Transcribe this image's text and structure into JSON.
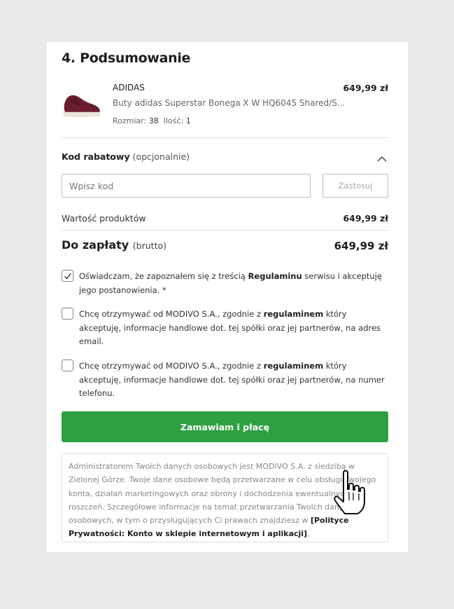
{
  "summary": {
    "title": "4. Podsumowanie"
  },
  "product": {
    "brand": "ADIDAS",
    "name": "Buty adidas Superstar Bonega X W HQ6045 Shared/S...",
    "price": "649,99 zł",
    "size_label": "Rozmiar:",
    "size_value": "38",
    "qty_label": "Ilość:",
    "qty_value": "1"
  },
  "discount": {
    "label_bold": "Kod rabatowy",
    "label_optional": "(opcjonalnie)",
    "placeholder": "Wpisz kod",
    "apply_label": "Zastosuj"
  },
  "totals": {
    "products_label": "Wartość produktów",
    "products_value": "649,99 zł",
    "pay_label": "Do zapłaty",
    "pay_note": "(brutto)",
    "pay_value": "649,99 zł"
  },
  "consents": [
    {
      "checked": true,
      "text_before": "Oświadczam, że zapoznałem się z treścią ",
      "bold": "Regulaminu",
      "text_after": " serwisu i akceptuję jego postanowienia. *"
    },
    {
      "checked": false,
      "text_before": "Chcę otrzymywać od MODIVO S.A., zgodnie z ",
      "bold": "regulaminem",
      "text_after": " który akceptuję, informacje handlowe dot. tej spółki oraz jej partnerów, na adres email."
    },
    {
      "checked": false,
      "text_before": "Chcę otrzymywać od MODIVO S.A., zgodnie z ",
      "bold": "regulaminem",
      "text_after": " który akceptuję, informacje handlowe dot. tej spółki oraz jej partnerów, na numer telefonu."
    }
  ],
  "order_button": "Zamawiam i płacę",
  "privacy": {
    "text": "Administratorem Twoich danych osobowych jest MODIVO S.A. z siedzibą w Zielonej Górze. Twoje dane osobowe będą przetwarzane w celu obsługi Twojego konta, działań marketingowych oraz obrony i dochodzenia ewentualnych roszczeń. Szczegółowe informacje na temat przetwarzania Twoich danych osobowych, w tym o przysługujących Ci prawach znajdziesz w ",
    "link": "[Polityce Prywatności: Konto w sklepie internetowym i aplikacji]",
    "end": "."
  },
  "colors": {
    "primary": "#2fa041",
    "shoe": "#6b1f2e"
  },
  "icons": {
    "collapse": "chevron-up-icon",
    "checkbox": "checkmark-icon",
    "cursor": "hand-pointer-icon"
  }
}
